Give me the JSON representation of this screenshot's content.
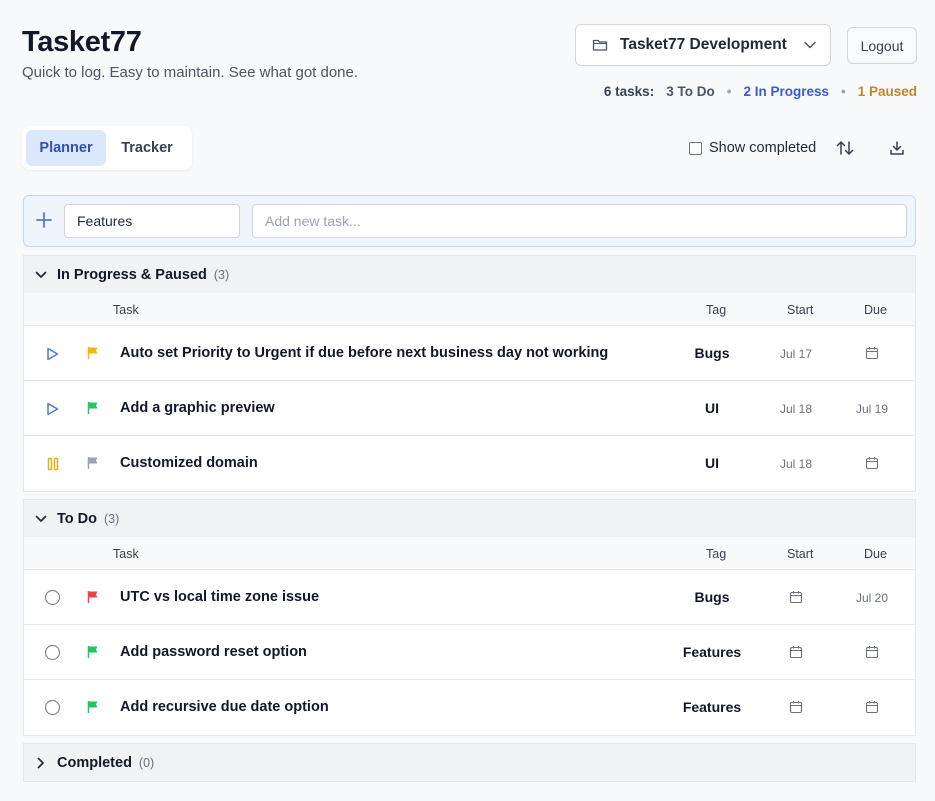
{
  "app": {
    "title": "Tasket77",
    "subtitle": "Quick to log. Easy to maintain. See what got done."
  },
  "header": {
    "project_selector": {
      "label": "Tasket77 Development",
      "icon": "folder-icon"
    },
    "logout_label": "Logout",
    "summary": {
      "total": "6 tasks:",
      "todo": "3 To Do",
      "in_progress": "2 In Progress",
      "paused": "1 Paused",
      "colors": {
        "total": "#374151",
        "todo": "#4b5563",
        "in_progress": "#3b5bcc",
        "paused": "#c0862a"
      }
    }
  },
  "tabs": [
    {
      "label": "Planner",
      "active": true
    },
    {
      "label": "Tracker",
      "active": false
    }
  ],
  "toolbar": {
    "show_completed_label": "Show completed",
    "show_completed_checked": false,
    "sort_icon": "sort-icon",
    "download_icon": "download-icon"
  },
  "add_bar": {
    "tag_value": "Features",
    "task_placeholder": "Add new task..."
  },
  "columns": {
    "task": "Task",
    "tag": "Tag",
    "start": "Start",
    "due": "Due"
  },
  "sections": {
    "in_progress": {
      "title": "In Progress & Paused",
      "count": "(3)",
      "expanded": true,
      "tasks": [
        {
          "status": "in-progress",
          "flag_color": "#f5b70a",
          "title": "Auto set Priority to Urgent if due before next business day not working",
          "tag": "Bugs",
          "start": "Jul 17",
          "due": ""
        },
        {
          "status": "in-progress",
          "flag_color": "#22c55e",
          "title": "Add a graphic preview",
          "tag": "UI",
          "start": "Jul 18",
          "due": "Jul 19"
        },
        {
          "status": "paused",
          "flag_color": "#9ca3af",
          "title": "Customized domain",
          "tag": "UI",
          "start": "Jul 18",
          "due": ""
        }
      ]
    },
    "todo": {
      "title": "To Do",
      "count": "(3)",
      "expanded": true,
      "tasks": [
        {
          "status": "todo",
          "flag_color": "#ef4444",
          "title": "UTC vs local time zone issue",
          "tag": "Bugs",
          "start": "",
          "due": "Jul 20"
        },
        {
          "status": "todo",
          "flag_color": "#22c55e",
          "title": "Add password reset option",
          "tag": "Features",
          "start": "",
          "due": ""
        },
        {
          "status": "todo",
          "flag_color": "#22c55e",
          "title": "Add recursive due date option",
          "tag": "Features",
          "start": "",
          "due": ""
        }
      ]
    },
    "completed": {
      "title": "Completed",
      "count": "(0)",
      "expanded": false
    }
  }
}
